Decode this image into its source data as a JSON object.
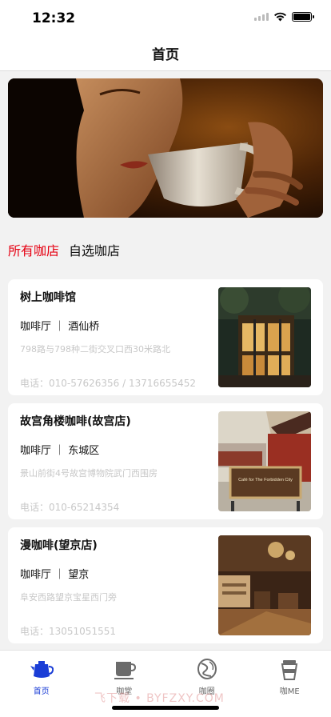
{
  "status": {
    "time": "12:32"
  },
  "nav": {
    "title": "首页"
  },
  "segment": {
    "items": [
      "所有咖店",
      "自选咖店"
    ],
    "active_index": 0,
    "active_color": "#e60012"
  },
  "shops": [
    {
      "name": "树上咖啡馆",
      "category": "咖啡厅 ｜ 酒仙桥",
      "address": "798路与798种二街交叉口西30米路北",
      "phone": "电话：010-57626356 / 13716655452"
    },
    {
      "name": "故宫角楼咖啡(故宫店)",
      "category": "咖啡厅 ｜ 东城区",
      "address": "景山前街4号故宫博物院武门西围房",
      "phone": "电话：010-65214354",
      "image_sign": "Café for The Forbidden City"
    },
    {
      "name": "漫咖啡(望京店)",
      "category": "咖啡厅 ｜ 望京",
      "address": "阜安西路望京宝星西门旁",
      "phone": "电话：13051051551"
    }
  ],
  "tabbar": {
    "items": [
      {
        "label": "首页",
        "icon": "coffee-pot-icon"
      },
      {
        "label": "咖堂",
        "icon": "coffee-cup-icon"
      },
      {
        "label": "咖圈",
        "icon": "coffee-bean-icon"
      },
      {
        "label": "咖ME",
        "icon": "takeaway-cup-icon"
      }
    ],
    "active_index": 0,
    "active_color": "#1a3dd6"
  },
  "watermark": "飞下载 • BYFZXY.COM"
}
